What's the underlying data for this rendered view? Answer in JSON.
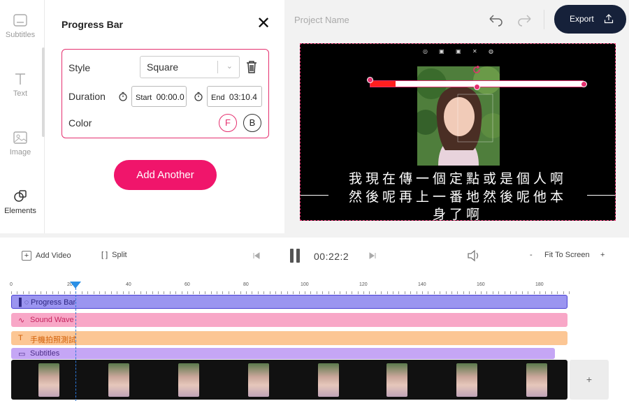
{
  "sidebar": {
    "items": [
      {
        "label": "Subtitles"
      },
      {
        "label": "Text"
      },
      {
        "label": "Image"
      },
      {
        "label": "Elements"
      }
    ]
  },
  "panel": {
    "title": "Progress Bar",
    "style_label": "Style",
    "style_value": "Square",
    "duration_label": "Duration",
    "start_label": "Start",
    "start_value": "00:00.0",
    "end_label": "End",
    "end_value": "03:10.4",
    "color_label": "Color",
    "color_fg": "F",
    "color_bg": "B",
    "add_another": "Add Another"
  },
  "topbar": {
    "project_name": "Project Name",
    "export_label": "Export"
  },
  "preview": {
    "subtitle_lines": [
      "我現在傳一個定點或是個人啊",
      "然後呢再上一番地然後呢他本",
      "身了啊"
    ],
    "progress_fraction": 0.12
  },
  "timeline": {
    "add_video": "Add Video",
    "split": "Split",
    "time": "00:22:2",
    "fit": "Fit To Screen",
    "zoom_out": "-",
    "zoom_in": "+",
    "ruler": [
      "0",
      "20",
      "40",
      "60",
      "80",
      "100",
      "120",
      "140",
      "160",
      "180"
    ],
    "tracks": [
      {
        "label": "Progress Bar"
      },
      {
        "label": "Sound Wave"
      },
      {
        "label": "手機拍照測試"
      },
      {
        "label": "Subtitles"
      }
    ],
    "add_clip": "+"
  },
  "colors": {
    "accent": "#f0156b",
    "export_bg": "#16213a",
    "track_progress": "#9b95f0",
    "track_wave": "#f8a7c7",
    "track_text": "#fcc694",
    "track_subs": "#c5a6f5"
  }
}
